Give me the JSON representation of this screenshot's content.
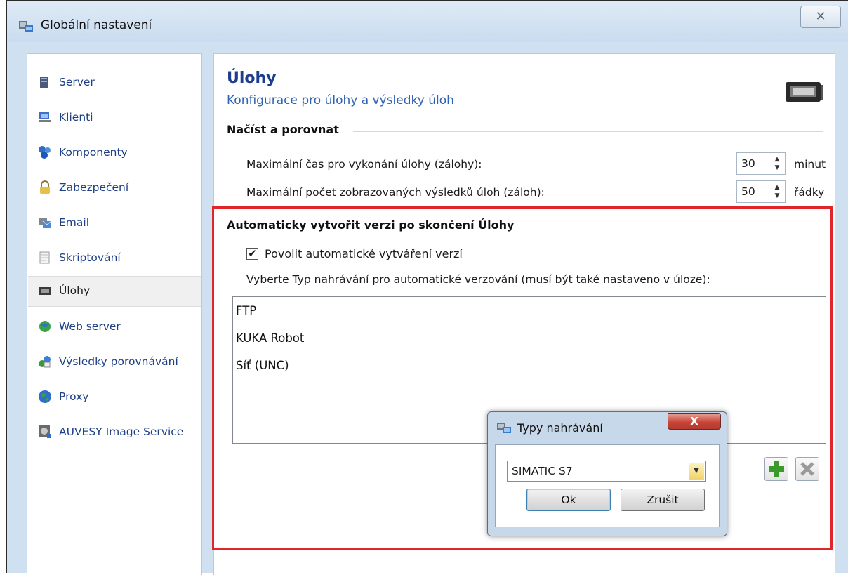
{
  "window": {
    "title": "Globální nastavení",
    "close_glyph": "✕"
  },
  "sidebar": {
    "items": [
      {
        "label": "Server",
        "icon": "server-icon"
      },
      {
        "label": "Klienti",
        "icon": "clients-icon"
      },
      {
        "label": "Komponenty",
        "icon": "components-icon"
      },
      {
        "label": "Zabezpečení",
        "icon": "lock-icon"
      },
      {
        "label": "Email",
        "icon": "email-icon"
      },
      {
        "label": "Skriptování",
        "icon": "script-icon"
      },
      {
        "label": "Úlohy",
        "icon": "tape-icon",
        "active": true
      },
      {
        "label": "Web server",
        "icon": "web-server-icon"
      },
      {
        "label": "Výsledky porovnávání",
        "icon": "compare-results-icon"
      },
      {
        "label": "Proxy",
        "icon": "globe-icon"
      },
      {
        "label": "AUVESY Image Service",
        "icon": "image-service-icon"
      }
    ]
  },
  "main": {
    "title": "Úlohy",
    "subtitle": "Konfigurace pro úlohy a výsledky úloh",
    "section_load": "Načíst a porovnat",
    "max_time_label": "Maximální čas pro vykonání úlohy (zálohy):",
    "max_time_value": "30",
    "max_time_unit": "minut",
    "max_results_label": "Maximální počet zobrazovaných výsledků úloh (záloh):",
    "max_results_value": "50",
    "max_results_unit": "řádky",
    "section_auto": "Automaticky vytvořit verzi po skončení Úlohy",
    "enable_checkbox_label": "Povolit automatické vytváření verzí",
    "enable_checked": true,
    "choose_label": "Vyberte Typ nahrávání pro automatické verzování (musí být také nastaveno v úloze):",
    "upload_types": [
      "FTP",
      "KUKA Robot",
      "Síť (UNC)"
    ]
  },
  "dialog": {
    "title": "Typy nahrávání",
    "close_glyph": "X",
    "combo_value": "SIMATIC S7",
    "ok_label": "Ok",
    "cancel_label": "Zrušit"
  },
  "colors": {
    "accent": "#1e3d8c",
    "link_blue": "#1d3f86",
    "highlight_red": "#e0262b",
    "add_green": "#3a9a2a"
  }
}
